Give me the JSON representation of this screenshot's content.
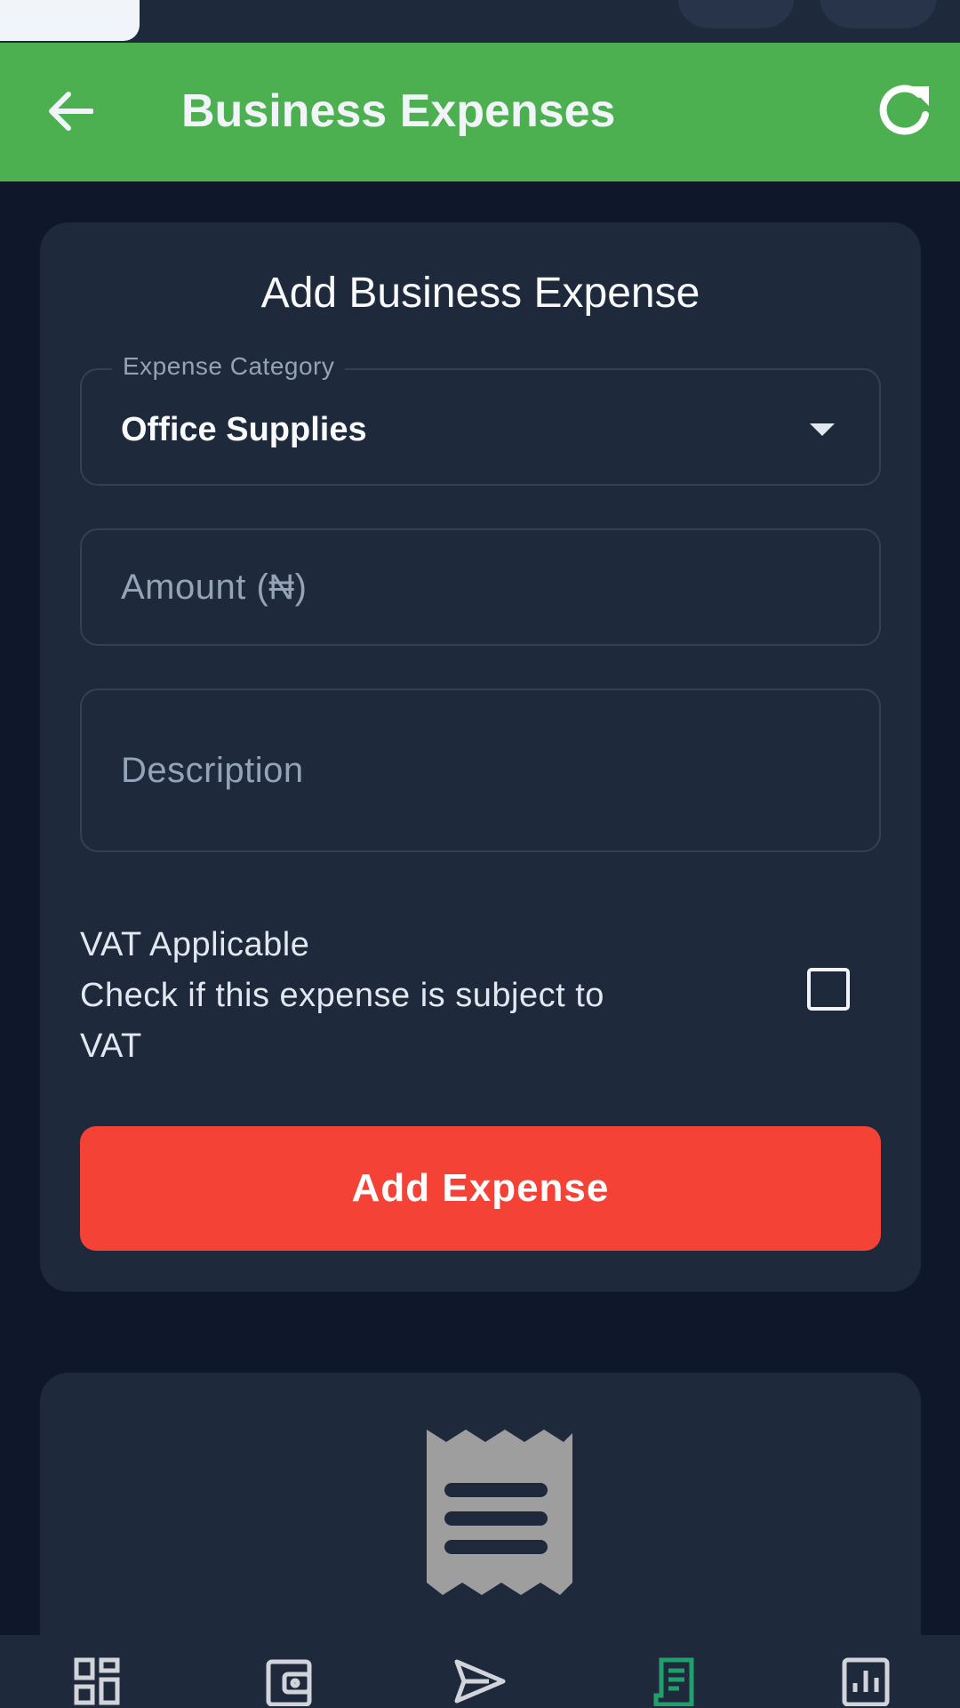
{
  "app_bar": {
    "title": "Business Expenses",
    "accent": "#4caf50"
  },
  "form": {
    "title": "Add Business Expense",
    "category": {
      "label": "Expense Category",
      "value": "Office Supplies"
    },
    "amount": {
      "placeholder": "Amount (₦)"
    },
    "description": {
      "placeholder": "Description"
    },
    "vat": {
      "title": "VAT Applicable",
      "line2": "Check if this expense is subject to",
      "line3": "VAT",
      "checked": false
    },
    "submit_label": "Add Expense",
    "submit_color": "#f44336"
  },
  "empty_state": {
    "icon": "receipt-icon"
  },
  "bottom_nav": {
    "items": [
      {
        "icon": "dashboard-icon",
        "active": false
      },
      {
        "icon": "wallet-icon",
        "active": false
      },
      {
        "icon": "send-icon",
        "active": false
      },
      {
        "icon": "receipt-icon",
        "active": true
      },
      {
        "icon": "reports-icon",
        "active": false
      }
    ],
    "active_color": "#22a06b"
  }
}
